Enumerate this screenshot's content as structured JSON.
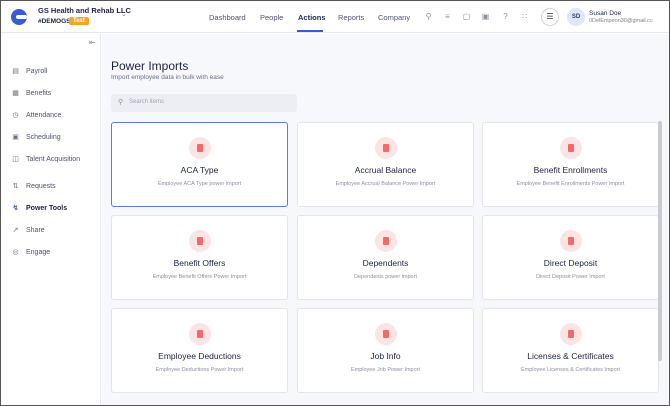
{
  "header": {
    "company_name": "GS Health and Rehab LLC",
    "company_code": "#DEMOGS",
    "env_badge": "Test",
    "nav": [
      {
        "label": "Dashboard"
      },
      {
        "label": "People"
      },
      {
        "label": "Actions"
      },
      {
        "label": "Reports"
      },
      {
        "label": "Company"
      }
    ],
    "active_nav": "Actions",
    "user": {
      "initials": "SD",
      "name": "Susan Doe",
      "email": "0DelEmpeon30@gmail.cc"
    }
  },
  "sidebar": {
    "items": [
      {
        "label": "Payroll",
        "icon": "payroll-icon"
      },
      {
        "label": "Benefits",
        "icon": "gift-icon"
      },
      {
        "label": "Attendance",
        "icon": "clock-icon"
      },
      {
        "label": "Scheduling",
        "icon": "calendar-icon"
      },
      {
        "label": "Talent Acquisition",
        "icon": "board-icon"
      },
      {
        "label": "Requests",
        "icon": "requests-icon"
      },
      {
        "label": "Power Tools",
        "icon": "bolt-icon"
      },
      {
        "label": "Share",
        "icon": "share-icon"
      },
      {
        "label": "Engage",
        "icon": "engage-icon"
      }
    ],
    "active": "Power Tools"
  },
  "page": {
    "title": "Power Imports",
    "subtitle": "Import employee data in bulk with ease",
    "search_placeholder": "Search items"
  },
  "cards": [
    {
      "title": "ACA Type",
      "desc": "Employee ACA Type power import",
      "selected": true
    },
    {
      "title": "Accrual Balance",
      "desc": "Employee Accrual Balance Power Import"
    },
    {
      "title": "Benefit Enrollments",
      "desc": "Employee Benefit Enrollments Power Import"
    },
    {
      "title": "Benefit Offers",
      "desc": "Employee Benefit Offers Power Import"
    },
    {
      "title": "Dependents",
      "desc": "Dependents power import"
    },
    {
      "title": "Direct Deposit",
      "desc": "Direct Deposit Power Import"
    },
    {
      "title": "Employee Deductions",
      "desc": "Employee Deductions Power Import"
    },
    {
      "title": "Job Info",
      "desc": "Employee Job Power Import"
    },
    {
      "title": "Licenses & Certificates",
      "desc": "Employee Licenses & Certificates Import"
    }
  ],
  "colors": {
    "accent": "#3a5ad8",
    "badge": "#f5a623",
    "card_icon": "#f26a6a"
  }
}
